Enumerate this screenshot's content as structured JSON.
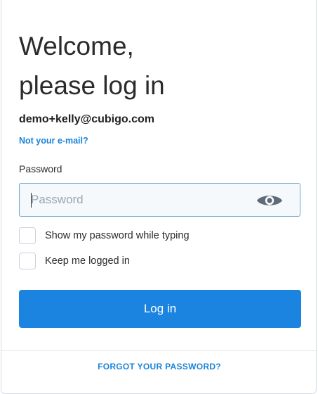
{
  "header": {
    "title_line1": "Welcome,",
    "title_line2": "please log in"
  },
  "account": {
    "email": "demo+kelly@cubigo.com",
    "not_your_email_link": "Not your e-mail?"
  },
  "password": {
    "label": "Password",
    "placeholder": "Password",
    "value": "",
    "toggle_icon": "eye-icon"
  },
  "options": {
    "show_password_label": "Show my password while typing",
    "show_password_checked": false,
    "keep_logged_in_label": "Keep me logged in",
    "keep_logged_in_checked": false
  },
  "actions": {
    "login_label": "Log in",
    "forgot_password_link": "FORGOT YOUR PASSWORD?"
  },
  "colors": {
    "accent": "#1a84e0",
    "link": "#1a84d8",
    "input_border": "#6aa6d3",
    "text": "#2b2b2b"
  }
}
